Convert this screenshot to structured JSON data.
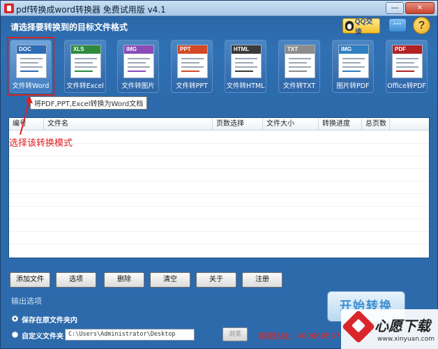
{
  "window": {
    "title": "pdf转换成word转换器 免费试用版 v4.1"
  },
  "header": {
    "prompt": "请选择要转换到的目标文件格式",
    "qq_label": "QQ交谈",
    "help_glyph": "?"
  },
  "modes": [
    {
      "tag": "DOC",
      "label": "文件转Word",
      "color": "#2e6bb6",
      "selected": true
    },
    {
      "tag": "XLS",
      "label": "文件转Excel",
      "color": "#2e8b3e",
      "selected": false
    },
    {
      "tag": "IMG",
      "label": "文件转图片",
      "color": "#8a4cb8",
      "selected": false
    },
    {
      "tag": "PPT",
      "label": "文件转PPT",
      "color": "#d24a26",
      "selected": false
    },
    {
      "tag": "HTML",
      "label": "文件转HTML",
      "color": "#3a3a3a",
      "selected": false
    },
    {
      "tag": "TXT",
      "label": "文件转TXT",
      "color": "#8c8c8c",
      "selected": false
    },
    {
      "tag": "IMG",
      "label": "图片转PDF",
      "color": "#2f7ec4",
      "selected": false
    },
    {
      "tag": "PDF",
      "label": "Office转PDF",
      "color": "#b22222",
      "selected": false
    }
  ],
  "tooltip": "将PDF,PPT,Excel转换为Word文档",
  "table": {
    "columns": [
      "编号",
      "文件名",
      "页数选择",
      "文件大小",
      "转换进度",
      "总页数"
    ]
  },
  "annotation": "选择该转换模式",
  "buttons": {
    "add": "添加文件",
    "options": "选项",
    "delete": "删除",
    "clear": "清空",
    "about": "关于",
    "register": "注册"
  },
  "output": {
    "section_title": "输出选项",
    "save_original": "保存在原文件夹内",
    "custom_folder": "自定义文件夹",
    "path": "C:\\Users\\Administrator\\Desktop",
    "browse": "浏览",
    "start": "开始转换",
    "hotline": "客服热线：400668557"
  },
  "watermark": {
    "name": "心愿下载",
    "url": "www.xinyuan.com"
  },
  "colors": {
    "accent": "#2e6fb0",
    "annotation": "#e02020",
    "start": "#3a8ed0"
  }
}
